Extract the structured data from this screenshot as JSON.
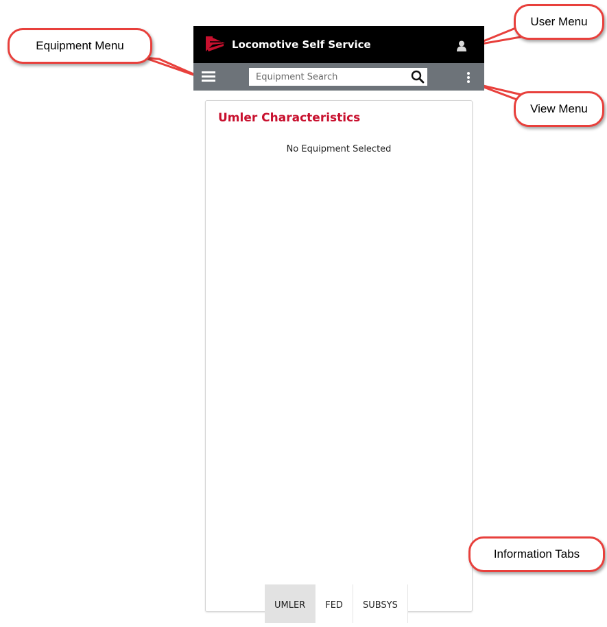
{
  "header": {
    "app_title": "Locomotive Self Service",
    "logo_icon": "railroad-logo-icon",
    "user_icon": "user-icon"
  },
  "searchbar": {
    "menu_icon": "hamburger-menu-icon",
    "search_placeholder": "Equipment Search",
    "search_value": "",
    "search_icon": "search-icon",
    "view_menu_icon": "vertical-dots-icon"
  },
  "card": {
    "title": "Umler Characteristics",
    "empty_message": "No Equipment Selected"
  },
  "tabs": [
    {
      "label": "UMLER",
      "active": true
    },
    {
      "label": "FED",
      "active": false
    },
    {
      "label": "SUBSYS",
      "active": false
    }
  ],
  "callouts": {
    "equipment_menu": "Equipment Menu",
    "user_menu": "User Menu",
    "view_menu": "View Menu",
    "information_tabs": "Information Tabs"
  },
  "colors": {
    "header_bg": "#000000",
    "searchbar_bg": "#6d7379",
    "accent_red": "#c8102e",
    "callout_border": "#e8403c"
  }
}
